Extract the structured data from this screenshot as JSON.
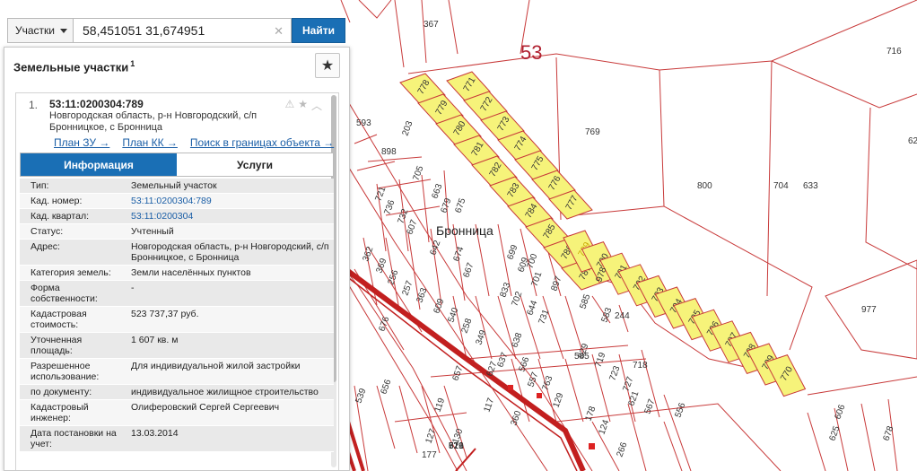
{
  "map": {
    "quarter_label": "53",
    "place_label": "Бронница",
    "parcel_labels": [
      "367",
      "716",
      "769",
      "800",
      "704",
      "633",
      "977",
      "898",
      "203",
      "705",
      "663",
      "679",
      "675",
      "642",
      "674",
      "667",
      "721",
      "736",
      "732",
      "607",
      "699",
      "609",
      "700",
      "701",
      "897",
      "978",
      "585",
      "583",
      "362",
      "369",
      "256",
      "257",
      "363",
      "609",
      "540",
      "258",
      "349",
      "833",
      "702",
      "644",
      "731",
      "676",
      "627",
      "637",
      "638",
      "566",
      "557",
      "763",
      "629",
      "719",
      "723",
      "727",
      "621",
      "567",
      "657",
      "656",
      "539",
      "119",
      "117",
      "127",
      "130",
      "360",
      "129",
      "178",
      "124",
      "266",
      "556",
      "606",
      "625",
      "678",
      "596",
      "590",
      "593",
      "244",
      "177",
      "718",
      "585",
      "627",
      "821",
      "719",
      "616",
      "57"
    ],
    "selected_parcels_upper": [
      "778",
      "771",
      "779",
      "772",
      "780",
      "773",
      "781",
      "774",
      "782",
      "775",
      "783",
      "776",
      "784",
      "777",
      "785",
      "786",
      "787"
    ],
    "selected_parcels_lower": [
      "789",
      "790",
      "791",
      "792",
      "793",
      "794",
      "795",
      "796",
      "797",
      "798",
      "799",
      "770"
    ],
    "highlighted_parcel": "789"
  },
  "search": {
    "type_label": "Участки",
    "query": "58,451051 31,674951",
    "button_label": "Найти"
  },
  "panel": {
    "title": "Земельные участки",
    "count": "1",
    "result": {
      "index": "1.",
      "cadnum": "53:11:0200304:789",
      "address": "Новгородская область, р-н Новгородский, с/п Бронницкое, с Бронница",
      "links": [
        "План ЗУ →",
        "План КК →",
        "Поиск в границах объекта →"
      ],
      "tabs": [
        "Информация",
        "Услуги"
      ],
      "attributes": [
        {
          "key": "Тип:",
          "value": "Земельный участок"
        },
        {
          "key": "Кад. номер:",
          "value": "53:11:0200304:789"
        },
        {
          "key": "Кад. квартал:",
          "value": "53:11:0200304"
        },
        {
          "key": "Статус:",
          "value": "Учтенный"
        },
        {
          "key": "Адрес:",
          "value": "Новгородская область, р-н Новгородский, с/п Бронницкое, с Бронница"
        },
        {
          "key": "Категория земель:",
          "value": "Земли населённых пунктов"
        },
        {
          "key": "Форма собственности:",
          "value": "-"
        },
        {
          "key": "Кадастровая стоимость:",
          "value": "523 737,37 руб."
        },
        {
          "key": "Уточненная площадь:",
          "value": "1 607 кв. м"
        },
        {
          "key": "Разрешенное использование:",
          "value": "Для индивидуальной жилой застройки"
        },
        {
          "key": "по документу:",
          "value": "индивидуальное жилищное строительство"
        },
        {
          "key": "Кадастровый инженер:",
          "value": "Олиферовский Сергей Сергеевич"
        },
        {
          "key": "Дата постановки на учет:",
          "value": "13.03.2014"
        }
      ]
    }
  },
  "colors": {
    "parcel_line": "#c83a3a",
    "selected_fill": "#f6f37a",
    "road": "#c21f1f",
    "accent": "#1a6fb5"
  }
}
